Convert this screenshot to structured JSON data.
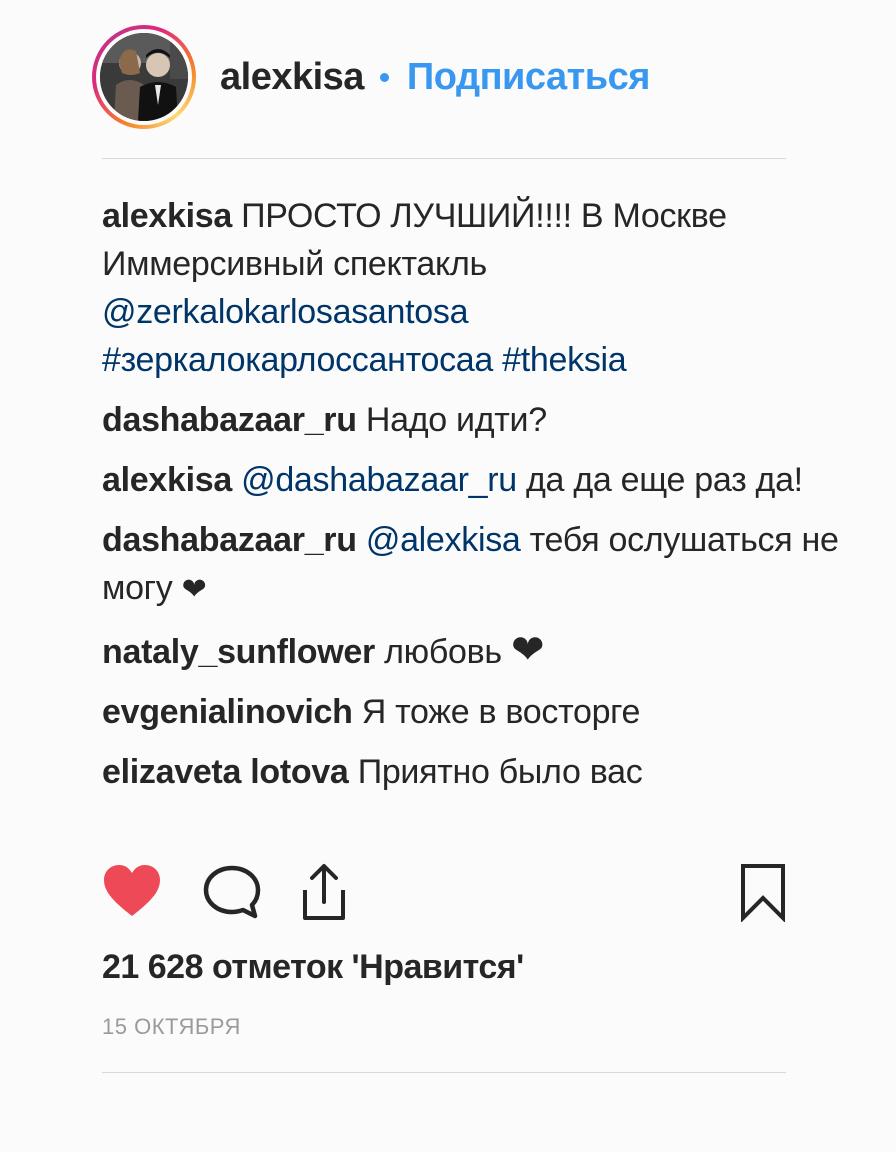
{
  "header": {
    "username": "alexkisa",
    "follow_label": "Подписаться",
    "avatar_icon": "profile-photo"
  },
  "comments": [
    {
      "user": "alexkisa",
      "parts": [
        {
          "type": "text",
          "value": "ПРОСТО ЛУЧШИЙ!!!! В Москве Иммерсивный спектакль "
        },
        {
          "type": "link",
          "value": "@zerkalokarlosasantosa"
        },
        {
          "type": "text",
          "value": " "
        },
        {
          "type": "link",
          "value": "#зеркалокарлоссантосаа"
        },
        {
          "type": "text",
          "value": " "
        },
        {
          "type": "link",
          "value": "#theksia"
        }
      ]
    },
    {
      "user": "dashabazaar_ru",
      "parts": [
        {
          "type": "text",
          "value": "Надо идти?"
        }
      ]
    },
    {
      "user": "alexkisa",
      "parts": [
        {
          "type": "link",
          "value": "@dashabazaar_ru"
        },
        {
          "type": "text",
          "value": " да да еще раз да!"
        }
      ]
    },
    {
      "user": "dashabazaar_ru",
      "parts": [
        {
          "type": "link",
          "value": "@alexkisa"
        },
        {
          "type": "text",
          "value": " тебя ослушаться не могу "
        },
        {
          "type": "heart",
          "value": "❤"
        }
      ]
    },
    {
      "user": "nataly_sunflower",
      "parts": [
        {
          "type": "text",
          "value": "любовь "
        },
        {
          "type": "heart-big",
          "value": "❤"
        }
      ]
    },
    {
      "user": "evgenialinovich",
      "parts": [
        {
          "type": "text",
          "value": "Я тоже в восторге"
        }
      ]
    },
    {
      "user": "elizaveta lotova",
      "parts": [
        {
          "type": "text",
          "value": "Приятно было вас"
        }
      ]
    }
  ],
  "actions": {
    "like_icon": "heart-filled-icon",
    "comment_icon": "comment-icon",
    "share_icon": "share-icon",
    "save_icon": "bookmark-icon",
    "like_color": "#ed4956"
  },
  "likes_text": "21 628 отметок 'Нравится'",
  "date_text": "15 ОКТЯБРЯ",
  "colors": {
    "link": "#003569",
    "follow": "#3897f0",
    "text": "#262626",
    "muted": "#9a9a9a"
  }
}
